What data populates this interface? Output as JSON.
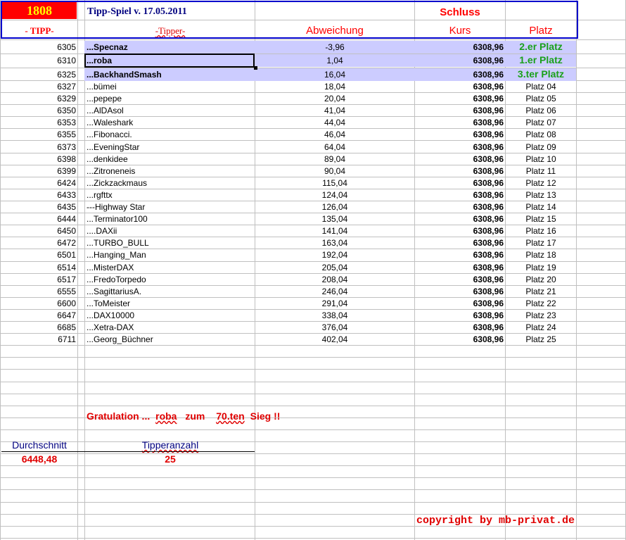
{
  "header": {
    "id_number": "1808",
    "title": "Tipp-Spiel v. 17.05.2011",
    "schluss": "Schluss",
    "col_tipp": "- TIPP-",
    "col_tipper": "-Tipper-",
    "col_abweichung": "Abweichung",
    "col_kurs": "Kurs",
    "col_platz": "Platz"
  },
  "rows": [
    {
      "tipp": "6305",
      "name": "...Specnaz",
      "abw": "-3,96",
      "kurs": "6308,96",
      "platz": "2.er Platz"
    },
    {
      "tipp": "6310",
      "name": "...roba",
      "abw": "1,04",
      "kurs": "6308,96",
      "platz": "1.er Platz"
    },
    {
      "tipp": "6325",
      "name": "...BackhandSmash",
      "abw": "16,04",
      "kurs": "6308,96",
      "platz": "3.ter Platz"
    },
    {
      "tipp": "6327",
      "name": "...bümei",
      "abw": "18,04",
      "kurs": "6308,96",
      "platz": "Platz 04"
    },
    {
      "tipp": "6329",
      "name": "...pepepe",
      "abw": "20,04",
      "kurs": "6308,96",
      "platz": "Platz 05"
    },
    {
      "tipp": "6350",
      "name": "...AlDAsol",
      "abw": "41,04",
      "kurs": "6308,96",
      "platz": "Platz 06"
    },
    {
      "tipp": "6353",
      "name": "...Waleshark",
      "abw": "44,04",
      "kurs": "6308,96",
      "platz": "Platz 07"
    },
    {
      "tipp": "6355",
      "name": "...Fibonacci.",
      "abw": "46,04",
      "kurs": "6308,96",
      "platz": "Platz 08"
    },
    {
      "tipp": "6373",
      "name": "...EveningStar",
      "abw": "64,04",
      "kurs": "6308,96",
      "platz": "Platz 09"
    },
    {
      "tipp": "6398",
      "name": "...denkidee",
      "abw": "89,04",
      "kurs": "6308,96",
      "platz": "Platz 10"
    },
    {
      "tipp": "6399",
      "name": "...Zitroneneis",
      "abw": "90,04",
      "kurs": "6308,96",
      "platz": "Platz 11"
    },
    {
      "tipp": "6424",
      "name": "...Zickzackmaus",
      "abw": "115,04",
      "kurs": "6308,96",
      "platz": "Platz 12"
    },
    {
      "tipp": "6433",
      "name": "...rgfttx",
      "abw": "124,04",
      "kurs": "6308,96",
      "platz": "Platz 13"
    },
    {
      "tipp": "6435",
      "name": "---Highway Star",
      "abw": "126,04",
      "kurs": "6308,96",
      "platz": "Platz 14"
    },
    {
      "tipp": "6444",
      "name": "...Terminator100",
      "abw": "135,04",
      "kurs": "6308,96",
      "platz": "Platz 15"
    },
    {
      "tipp": "6450",
      "name": "....DAXii",
      "abw": "141,04",
      "kurs": "6308,96",
      "platz": "Platz 16"
    },
    {
      "tipp": "6472",
      "name": "...TURBO_BULL",
      "abw": "163,04",
      "kurs": "6308,96",
      "platz": "Platz 17"
    },
    {
      "tipp": "6501",
      "name": "...Hanging_Man",
      "abw": "192,04",
      "kurs": "6308,96",
      "platz": "Platz 18"
    },
    {
      "tipp": "6514",
      "name": "...MisterDAX",
      "abw": "205,04",
      "kurs": "6308,96",
      "platz": "Platz 19"
    },
    {
      "tipp": "6517",
      "name": "...FredoTorpedo",
      "abw": "208,04",
      "kurs": "6308,96",
      "platz": "Platz 20"
    },
    {
      "tipp": "6555",
      "name": "...SagittariusA.",
      "abw": "246,04",
      "kurs": "6308,96",
      "platz": "Platz 21"
    },
    {
      "tipp": "6600",
      "name": "...ToMeister",
      "abw": "291,04",
      "kurs": "6308,96",
      "platz": "Platz 22"
    },
    {
      "tipp": "6647",
      "name": "...DAX10000",
      "abw": "338,04",
      "kurs": "6308,96",
      "platz": "Platz 23"
    },
    {
      "tipp": "6685",
      "name": "...Xetra-DAX",
      "abw": "376,04",
      "kurs": "6308,96",
      "platz": "Platz 24"
    },
    {
      "tipp": "6711",
      "name": "...Georg_Büchner",
      "abw": "402,04",
      "kurs": "6308,96",
      "platz": "Platz 25"
    }
  ],
  "gratulation": {
    "prefix": "Gratulation ...",
    "winner": "roba",
    "zum": "zum",
    "victory": "70.ten",
    "suffix": "Sieg !!"
  },
  "stats": {
    "durchschnitt_label": "Durchschnitt",
    "durchschnitt_value": "6448,48",
    "tipperanzahl_label": "Tipperanzahl",
    "tipperanzahl_value": "25"
  },
  "copyright": "copyright by mb-privat.de",
  "colors": {
    "header_red": "#ff0000",
    "id_yellow": "#ffff00",
    "title_blue": "#000080",
    "highlight_rows": "#ccccff",
    "green_place": "#1aa01a",
    "frame_blue": "#0000cc",
    "grid": "#c0c0c0"
  }
}
